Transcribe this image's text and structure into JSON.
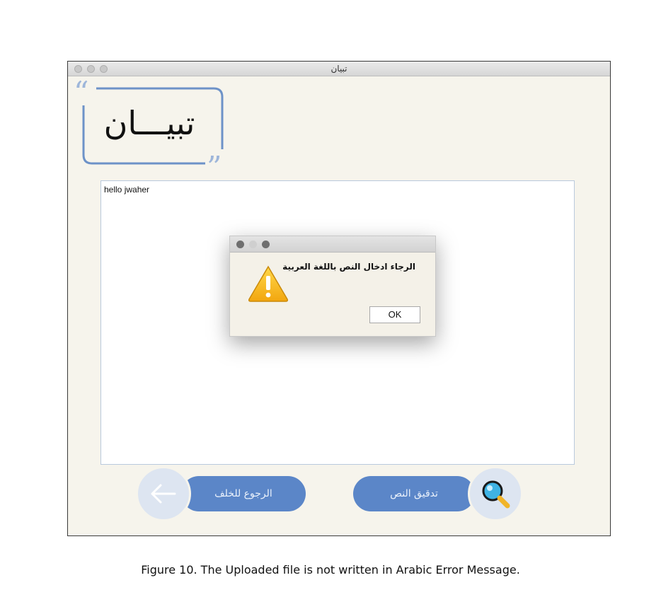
{
  "window": {
    "title": "تبيان"
  },
  "logo": {
    "text": "تبيـــان"
  },
  "editor": {
    "content": "hello jwaher"
  },
  "dialog": {
    "message": "الرجاء ادخال النص باللغة العربية",
    "ok_label": "OK",
    "icon": "warning-icon"
  },
  "buttons": {
    "back_label": "الرجوع للخلف",
    "back_icon": "arrow-left-icon",
    "check_label": "تدقيق النص",
    "check_icon": "magnifier-icon"
  },
  "caption": "Figure 10. The Uploaded file is not written in Arabic Error Message.",
  "colors": {
    "accent": "#5b86c8",
    "accent_light": "#dde5f1",
    "window_bg": "#f6f4ec"
  }
}
